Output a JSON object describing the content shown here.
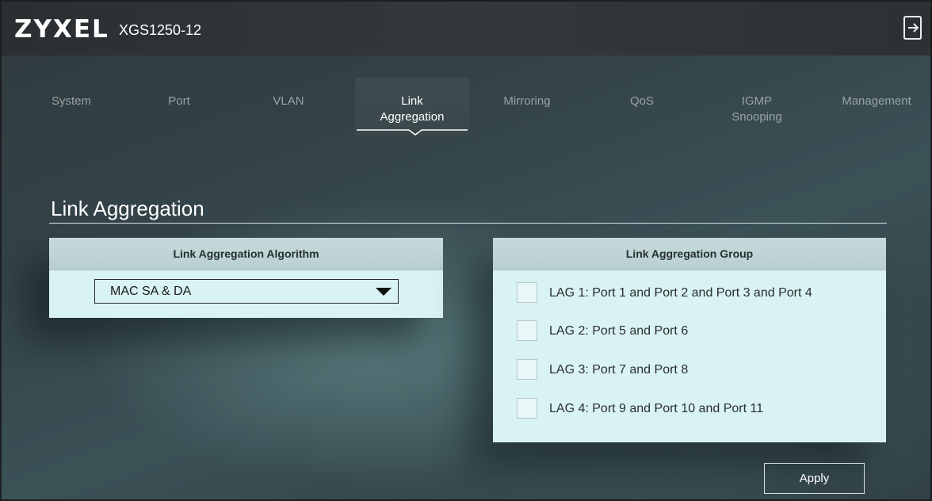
{
  "header": {
    "logo": "ZYXEL",
    "model": "XGS1250-12",
    "logout_icon": "logout-icon"
  },
  "tabs": [
    {
      "line1": "System",
      "line2": ""
    },
    {
      "line1": "Port",
      "line2": ""
    },
    {
      "line1": "VLAN",
      "line2": ""
    },
    {
      "line1": "Link",
      "line2": "Aggregation",
      "active": true
    },
    {
      "line1": "Mirroring",
      "line2": ""
    },
    {
      "line1": "QoS",
      "line2": ""
    },
    {
      "line1": "IGMP",
      "line2": "Snooping"
    },
    {
      "line1": "Management",
      "line2": ""
    }
  ],
  "page": {
    "title": "Link Aggregation"
  },
  "algorithm_panel": {
    "header": "Link Aggregation Algorithm",
    "selected_value": "MAC SA & DA"
  },
  "group_panel": {
    "header": "Link Aggregation Group",
    "items": [
      {
        "label": "LAG 1: Port 1 and Port 2 and Port 3 and Port 4",
        "checked": false
      },
      {
        "label": "LAG 2: Port 5 and Port 6",
        "checked": false
      },
      {
        "label": "LAG 3: Port 7 and Port 8",
        "checked": false
      },
      {
        "label": "LAG 4: Port 9 and Port 10 and Port 11",
        "checked": false
      }
    ]
  },
  "actions": {
    "apply_label": "Apply"
  },
  "colors": {
    "panel_bg": "#d9f2f3",
    "panel_header_bg": "#bfd4d6",
    "background": "#34444a",
    "active_tab_text": "#ffffff",
    "inactive_tab_text": "#9aa3a5"
  }
}
